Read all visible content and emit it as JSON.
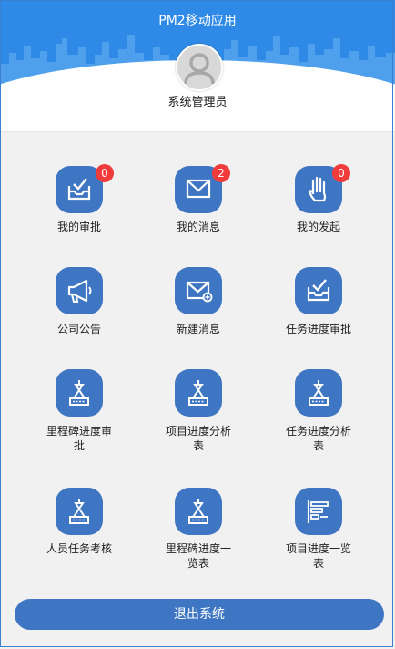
{
  "header": {
    "title": "PM2移动应用",
    "username": "系统管理员"
  },
  "menu": [
    {
      "label": "我的审批",
      "badge": "0",
      "icon": "inbox-check-icon"
    },
    {
      "label": "我的消息",
      "badge": "2",
      "icon": "envelope-icon"
    },
    {
      "label": "我的发起",
      "badge": "0",
      "icon": "hand-icon"
    },
    {
      "label": "公司公告",
      "icon": "megaphone-icon"
    },
    {
      "label": "新建消息",
      "icon": "new-mail-icon"
    },
    {
      "label": "任务进度审批",
      "icon": "inbox-check-icon"
    },
    {
      "label_line1": "里程碑进度审",
      "label_line2": "批",
      "icon": "crane-hook-icon"
    },
    {
      "label_line1": "项目进度分析",
      "label_line2": "表",
      "icon": "crane-hook-icon"
    },
    {
      "label_line1": "任务进度分析",
      "label_line2": "表",
      "icon": "crane-hook-icon"
    },
    {
      "label": "人员任务考核",
      "icon": "crane-hook-icon"
    },
    {
      "label_line1": "里程碑进度一",
      "label_line2": "览表",
      "icon": "crane-hook-icon"
    },
    {
      "label_line1": "项目进度一览",
      "label_line2": "表",
      "icon": "gantt-chart-icon"
    }
  ],
  "logout": {
    "label": "退出系统"
  },
  "colors": {
    "header_blue": "#2e8ae6",
    "icon_blue": "#3f76c3",
    "badge_red": "#f23b3b"
  }
}
